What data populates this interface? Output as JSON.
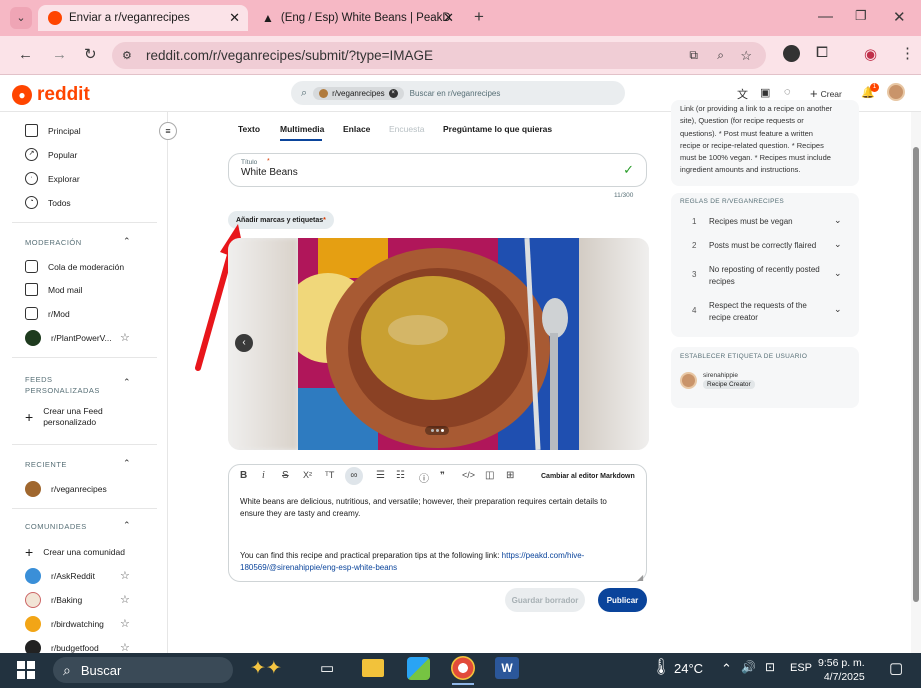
{
  "browser": {
    "tabs": [
      {
        "label": "Enviar a r/veganrecipes",
        "active": true
      },
      {
        "label": "(Eng / Esp) White Beans | PeakD",
        "active": false
      }
    ],
    "url": "reddit.com/r/veganrecipes/submit/?type=IMAGE",
    "accent": "#f6b8c5"
  },
  "header": {
    "logo": "reddit",
    "search_chip": "r/veganrecipes",
    "search_placeholder": "Buscar en r/veganrecipes",
    "create_label": "Crear",
    "notification_count": "1"
  },
  "sidebar": {
    "main": [
      {
        "label": "Principal",
        "icon": "home-icon"
      },
      {
        "label": "Popular",
        "icon": "popular-icon"
      },
      {
        "label": "Explorar",
        "icon": "explore-icon"
      },
      {
        "label": "Todos",
        "icon": "all-icon"
      }
    ],
    "moderation_header": "MODERACIÓN",
    "moderation": [
      {
        "label": "Cola de moderación"
      },
      {
        "label": "Mod mail"
      },
      {
        "label": "r/Mod"
      },
      {
        "label": "r/PlantPowerV..."
      }
    ],
    "feeds_header_line1": "FEEDS",
    "feeds_header_line2": "PERSONALIZADAS",
    "create_feed_line1": "Crear una Feed",
    "create_feed_line2": "personalizado",
    "recent_header": "RECIENTE",
    "recent": [
      {
        "label": "r/veganrecipes"
      }
    ],
    "communities_header": "COMUNIDADES",
    "create_community": "Crear una comunidad",
    "communities": [
      {
        "label": "r/AskReddit"
      },
      {
        "label": "r/Baking"
      },
      {
        "label": "r/birdwatching"
      },
      {
        "label": "r/budgetfood"
      }
    ]
  },
  "post": {
    "tabs": [
      "Texto",
      "Multimedia",
      "Enlace",
      "Encuesta",
      "Pregúntame lo que quieras"
    ],
    "active_tab": "Multimedia",
    "title_label": "Título",
    "title_value": "White Beans",
    "char_count": "11/300",
    "add_tags": "Añadir marcas y etiquetas",
    "markdown_toggle": "Cambiar al editor Markdown",
    "body_p1_line1": "White beans are delicious, nutritious, and versatile; however, their preparation requires certain details to",
    "body_p1_line2": "ensure they are tasty and creamy.",
    "body_p2_line1": "You can find this recipe and practical preparation tips at the following link: ",
    "body_link_line1": "https://peakd.com/hive-",
    "body_link_line2": "180569/@sirenahippie/eng-esp-white-beans",
    "save_draft": "Guardar borrador",
    "publish": "Publicar"
  },
  "right": {
    "about_lines": [
      "Link (or providing a link to a recipe on another",
      "site), Question (for recipe requests or",
      "questions). * Post must feature a written",
      "recipe or recipe-related question. * Recipes",
      "must be 100% vegan. * Recipes must include",
      "ingredient amounts and instructions."
    ],
    "rules_header": "REGLAS DE R/VEGANRECIPES",
    "rules": [
      {
        "num": "1",
        "line1": "Recipes must be vegan",
        "line2": ""
      },
      {
        "num": "2",
        "line1": "Posts must be correctly flaired",
        "line2": ""
      },
      {
        "num": "3",
        "line1": "No reposting of recently posted",
        "line2": "recipes"
      },
      {
        "num": "4",
        "line1": "Respect the requests of the",
        "line2": "recipe creator"
      }
    ],
    "flair_header": "ESTABLECER ETIQUETA DE USUARIO",
    "username": "sirenahippie",
    "flair": "Recipe Creator"
  },
  "taskbar": {
    "search": "Buscar",
    "temp": "24°C",
    "lang": "ESP",
    "time": "9:56 p. m.",
    "date": "4/7/2025"
  }
}
